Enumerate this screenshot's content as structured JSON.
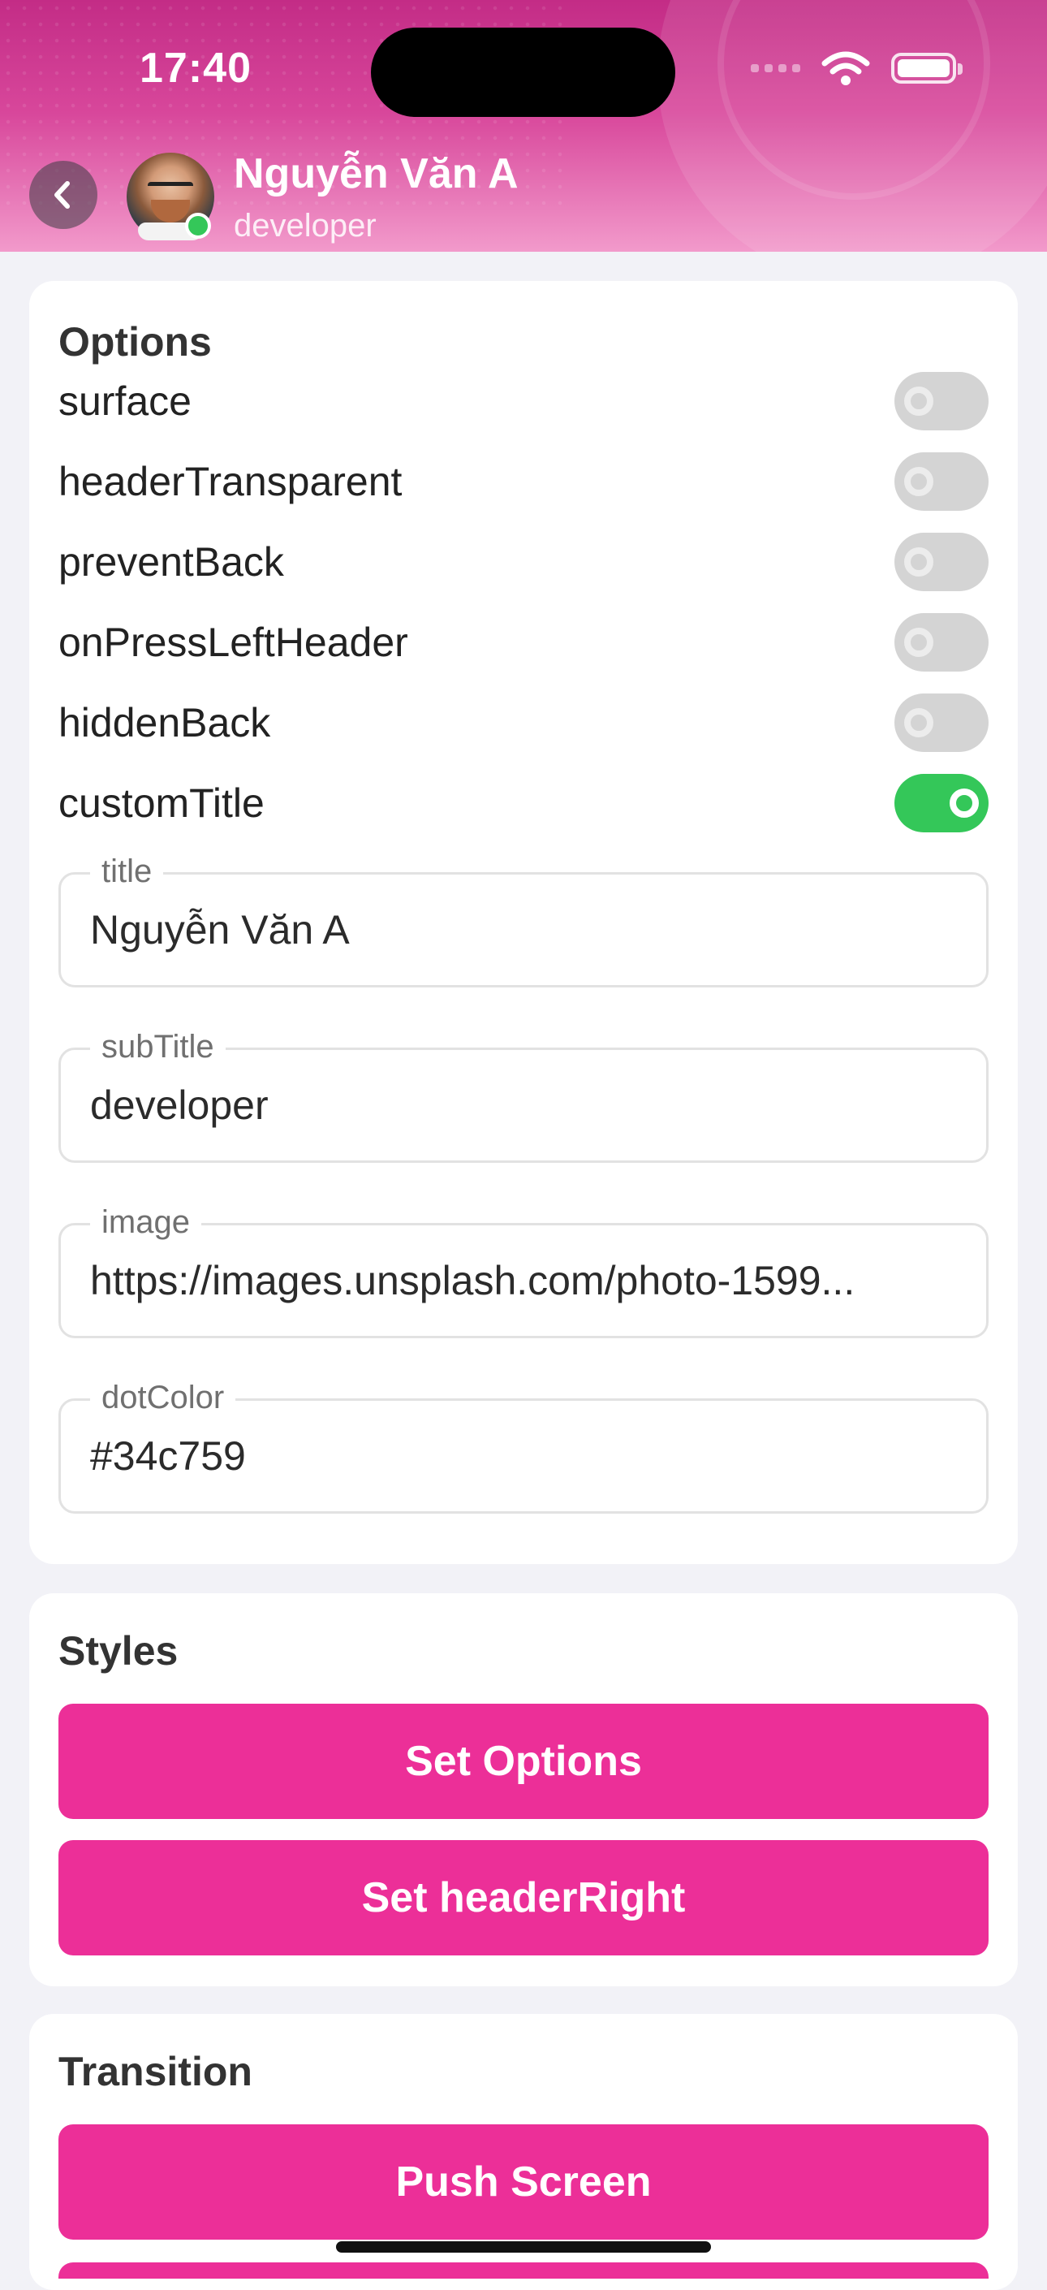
{
  "status_bar": {
    "time": "17:40"
  },
  "header": {
    "title": "Nguyễn Văn A",
    "subtitle": "developer",
    "dot_color": "#34c759"
  },
  "options": {
    "title": "Options",
    "toggles": [
      {
        "label": "surface",
        "on": false
      },
      {
        "label": "headerTransparent",
        "on": false
      },
      {
        "label": "preventBack",
        "on": false
      },
      {
        "label": "onPressLeftHeader",
        "on": false
      },
      {
        "label": "hiddenBack",
        "on": false
      },
      {
        "label": "customTitle",
        "on": true
      }
    ],
    "fields": [
      {
        "label": "title",
        "value": "Nguyễn Văn A"
      },
      {
        "label": "subTitle",
        "value": "developer"
      },
      {
        "label": "image",
        "value": "https://images.unsplash.com/photo-1599..."
      },
      {
        "label": "dotColor",
        "value": "#34c759"
      }
    ]
  },
  "styles": {
    "title": "Styles",
    "buttons": [
      "Set Options",
      "Set headerRight"
    ]
  },
  "transition": {
    "title": "Transition",
    "buttons": [
      "Push Screen"
    ]
  },
  "colors": {
    "accent": "#ec2f98",
    "switch_on": "#34c759",
    "switch_off": "#d4d4d4",
    "background": "#f2f2f7"
  }
}
